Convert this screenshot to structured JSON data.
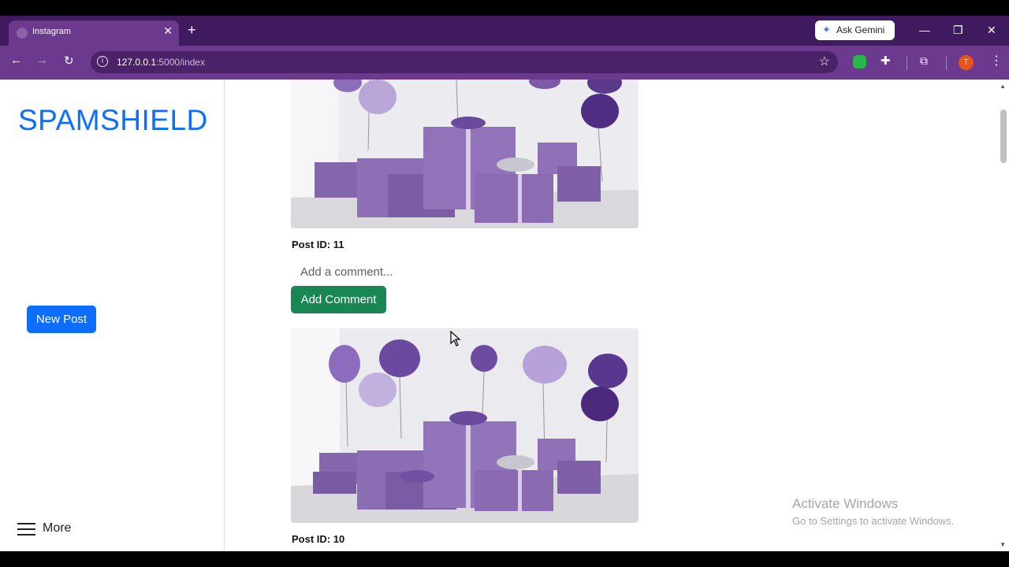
{
  "browser": {
    "tab_title": "Instagram",
    "tab_close": "✕",
    "new_tab": "+",
    "gemini_label": "Ask Gemini",
    "url_host": "127.0.0.1",
    "url_path": ":5000/index",
    "profile_initial": "T",
    "window": {
      "minimize": "—",
      "restore": "❐",
      "close": "✕"
    }
  },
  "sidebar": {
    "brand": "SPAMSHIELD",
    "new_post": "New Post",
    "more": "More"
  },
  "posts": [
    {
      "id_label": "Post ID: 11",
      "comment_placeholder": "Add a comment...",
      "add_comment": "Add Comment"
    },
    {
      "id_label": "Post ID: 10"
    }
  ],
  "watermark": {
    "line1": "Activate Windows",
    "line2": "Go to Settings to activate Windows."
  },
  "colors": {
    "accent": "#6b3a8f",
    "brand": "#0d6efd",
    "add_comment": "#198754"
  }
}
